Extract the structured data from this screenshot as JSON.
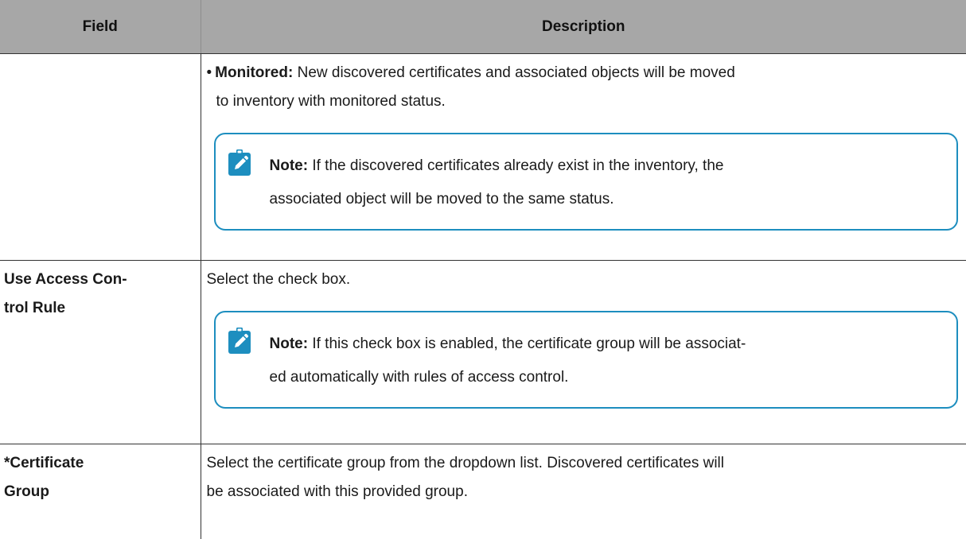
{
  "table": {
    "headers": [
      "Field",
      "Description"
    ],
    "rows": [
      {
        "field": "",
        "bullet": {
          "marker": "•",
          "label": "Monitored:",
          "text_line1": " New discovered certificates and associated objects will be moved",
          "text_line2": "to inventory with monitored status."
        },
        "note": {
          "icon": "note-pencil-icon",
          "label": "Note:",
          "text_line1": " If the discovered certificates already exist in the inventory, the",
          "text_line2": "associated object will be moved to the same status."
        }
      },
      {
        "field_line1": "Use Access Con-",
        "field_line2": "trol Rule",
        "text": "Select the check box.",
        "note": {
          "icon": "note-pencil-icon",
          "label": "Note:",
          "text_line1": " If this check box is enabled, the certificate group will be associat-",
          "text_line2": "ed automatically with rules of access control."
        }
      },
      {
        "field_line1": "*Certificate",
        "field_line2": "Group",
        "text_line1": "Select the certificate group from the dropdown list. Discovered certificates will",
        "text_line2": "be associated with this provided group."
      }
    ]
  },
  "colors": {
    "header_bg": "#a7a7a7",
    "note_border": "#1d8ebf",
    "icon_bg": "#1d8ebf"
  }
}
